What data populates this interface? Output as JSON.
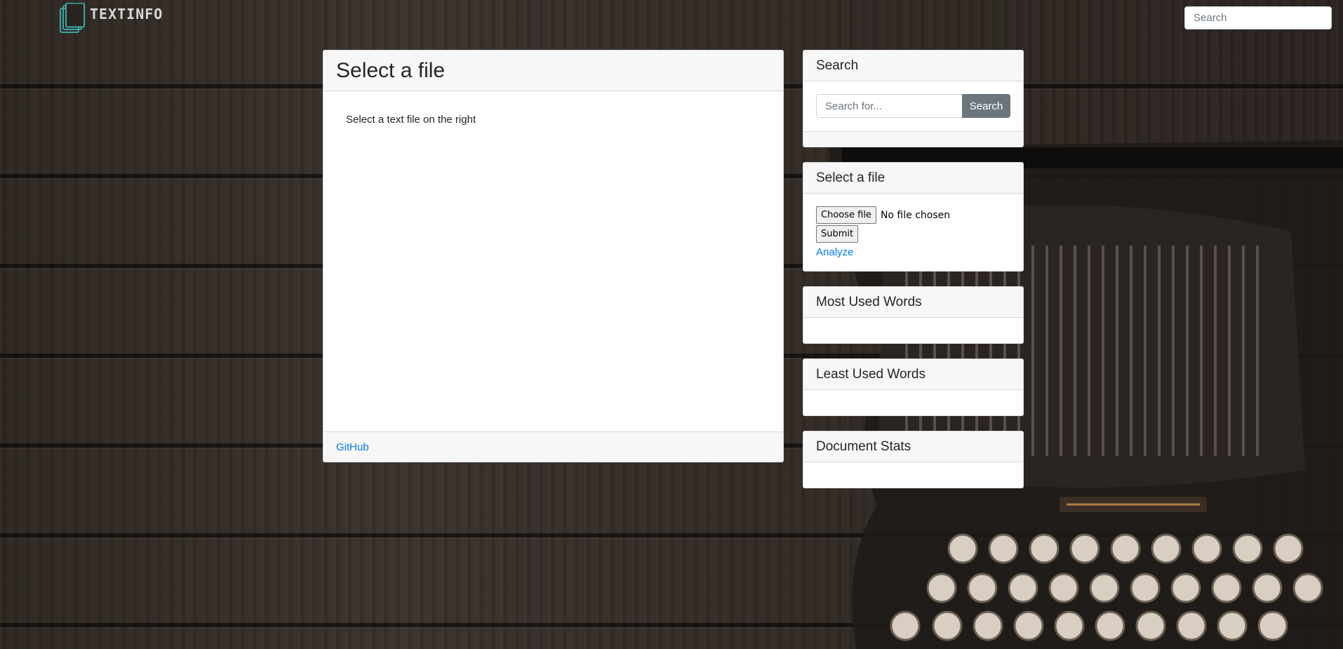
{
  "nav": {
    "brand": "TEXTINFO",
    "search_placeholder": "Search"
  },
  "main": {
    "title": "Select a file",
    "body_text": "Select a text file on the right",
    "footer_link": "GitHub"
  },
  "sidebar": {
    "search": {
      "title": "Search",
      "placeholder": "Search for...",
      "button": "Search"
    },
    "file": {
      "title": "Select a file",
      "choose_button": "Choose file",
      "status": "No file chosen",
      "submit_button": "Submit",
      "analyze_link": "Analyze"
    },
    "most_used": {
      "title": "Most Used Words"
    },
    "least_used": {
      "title": "Least Used Words"
    },
    "doc_stats": {
      "title": "Document Stats"
    }
  },
  "colors": {
    "link": "#007bff",
    "secondary_button": "#6c757d",
    "card_header_bg": "#f7f7f7",
    "logo_accent": "#3aa6a8"
  },
  "icons": {
    "brand": "stacked-documents-icon"
  }
}
